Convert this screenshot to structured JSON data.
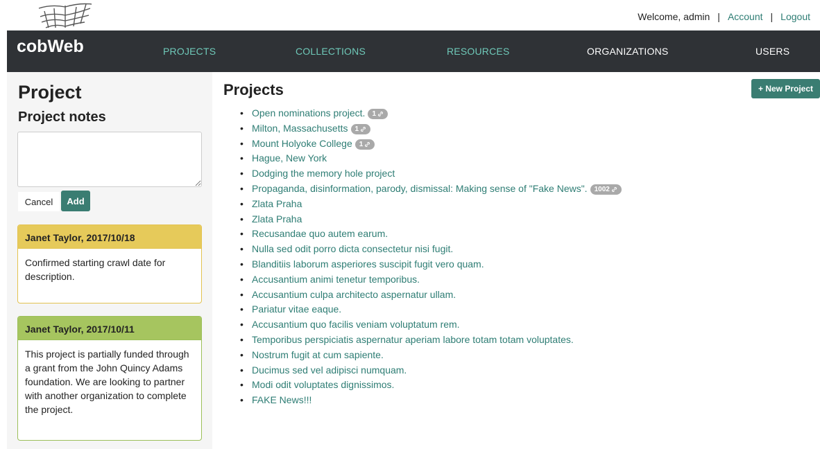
{
  "header": {
    "welcome": "Welcome, admin",
    "separator": "|",
    "account": "Account",
    "logout": "Logout"
  },
  "nav": {
    "brand": "cobWeb",
    "items": [
      {
        "label": "PROJECTS",
        "active": true
      },
      {
        "label": "COLLECTIONS",
        "active": true
      },
      {
        "label": "RESOURCES",
        "active": true
      },
      {
        "label": "ORGANIZATIONS",
        "active": false
      },
      {
        "label": "USERS",
        "active": false
      }
    ]
  },
  "sidebar": {
    "title": "Project",
    "subtitle": "Project notes",
    "note_input_value": "",
    "cancel_label": "Cancel",
    "add_label": "Add",
    "notes": [
      {
        "author_date": "Janet Taylor, 2017/10/18",
        "text": "Confirmed starting crawl date for description.",
        "color": "#e6ca5a"
      },
      {
        "author_date": "Janet Taylor, 2017/10/11",
        "text": "This project is partially funded through a grant from the John Quincy Adams foundation. We are looking to partner with another organization to complete the project.",
        "color": "#a6c55f"
      }
    ]
  },
  "main": {
    "title": "Projects",
    "new_project_label": "+ New Project",
    "projects": [
      {
        "name": "Open nominations project.",
        "badge": "1"
      },
      {
        "name": "Milton, Massachusetts",
        "badge": "1"
      },
      {
        "name": "Mount Holyoke College",
        "badge": "1"
      },
      {
        "name": "Hague, New York",
        "badge": ""
      },
      {
        "name": "Dodging the memory hole project",
        "badge": ""
      },
      {
        "name": "Propaganda, disinformation, parody, dismissal: Making sense of \"Fake News\".",
        "badge": "1002"
      },
      {
        "name": "Zlata Praha",
        "badge": ""
      },
      {
        "name": "Zlata Praha",
        "badge": ""
      },
      {
        "name": "Recusandae quo autem earum.",
        "badge": ""
      },
      {
        "name": "Nulla sed odit porro dicta consectetur nisi fugit.",
        "badge": ""
      },
      {
        "name": "Blanditiis laborum asperiores suscipit fugit vero quam.",
        "badge": ""
      },
      {
        "name": "Accusantium animi tenetur temporibus.",
        "badge": ""
      },
      {
        "name": "Accusantium culpa architecto aspernatur ullam.",
        "badge": ""
      },
      {
        "name": "Pariatur vitae eaque.",
        "badge": ""
      },
      {
        "name": "Accusantium quo facilis veniam voluptatum rem.",
        "badge": ""
      },
      {
        "name": "Temporibus perspiciatis aspernatur aperiam labore totam totam voluptates.",
        "badge": ""
      },
      {
        "name": "Nostrum fugit at cum sapiente.",
        "badge": ""
      },
      {
        "name": "Ducimus sed vel adipisci numquam.",
        "badge": ""
      },
      {
        "name": "Modi odit voluptates dignissimos.",
        "badge": ""
      },
      {
        "name": "FAKE News!!!",
        "badge": ""
      }
    ]
  },
  "colors": {
    "accent": "#3a7d72",
    "link": "#2e7d74",
    "nav_bg": "#2f3236",
    "nav_active": "#6fc9b9"
  }
}
